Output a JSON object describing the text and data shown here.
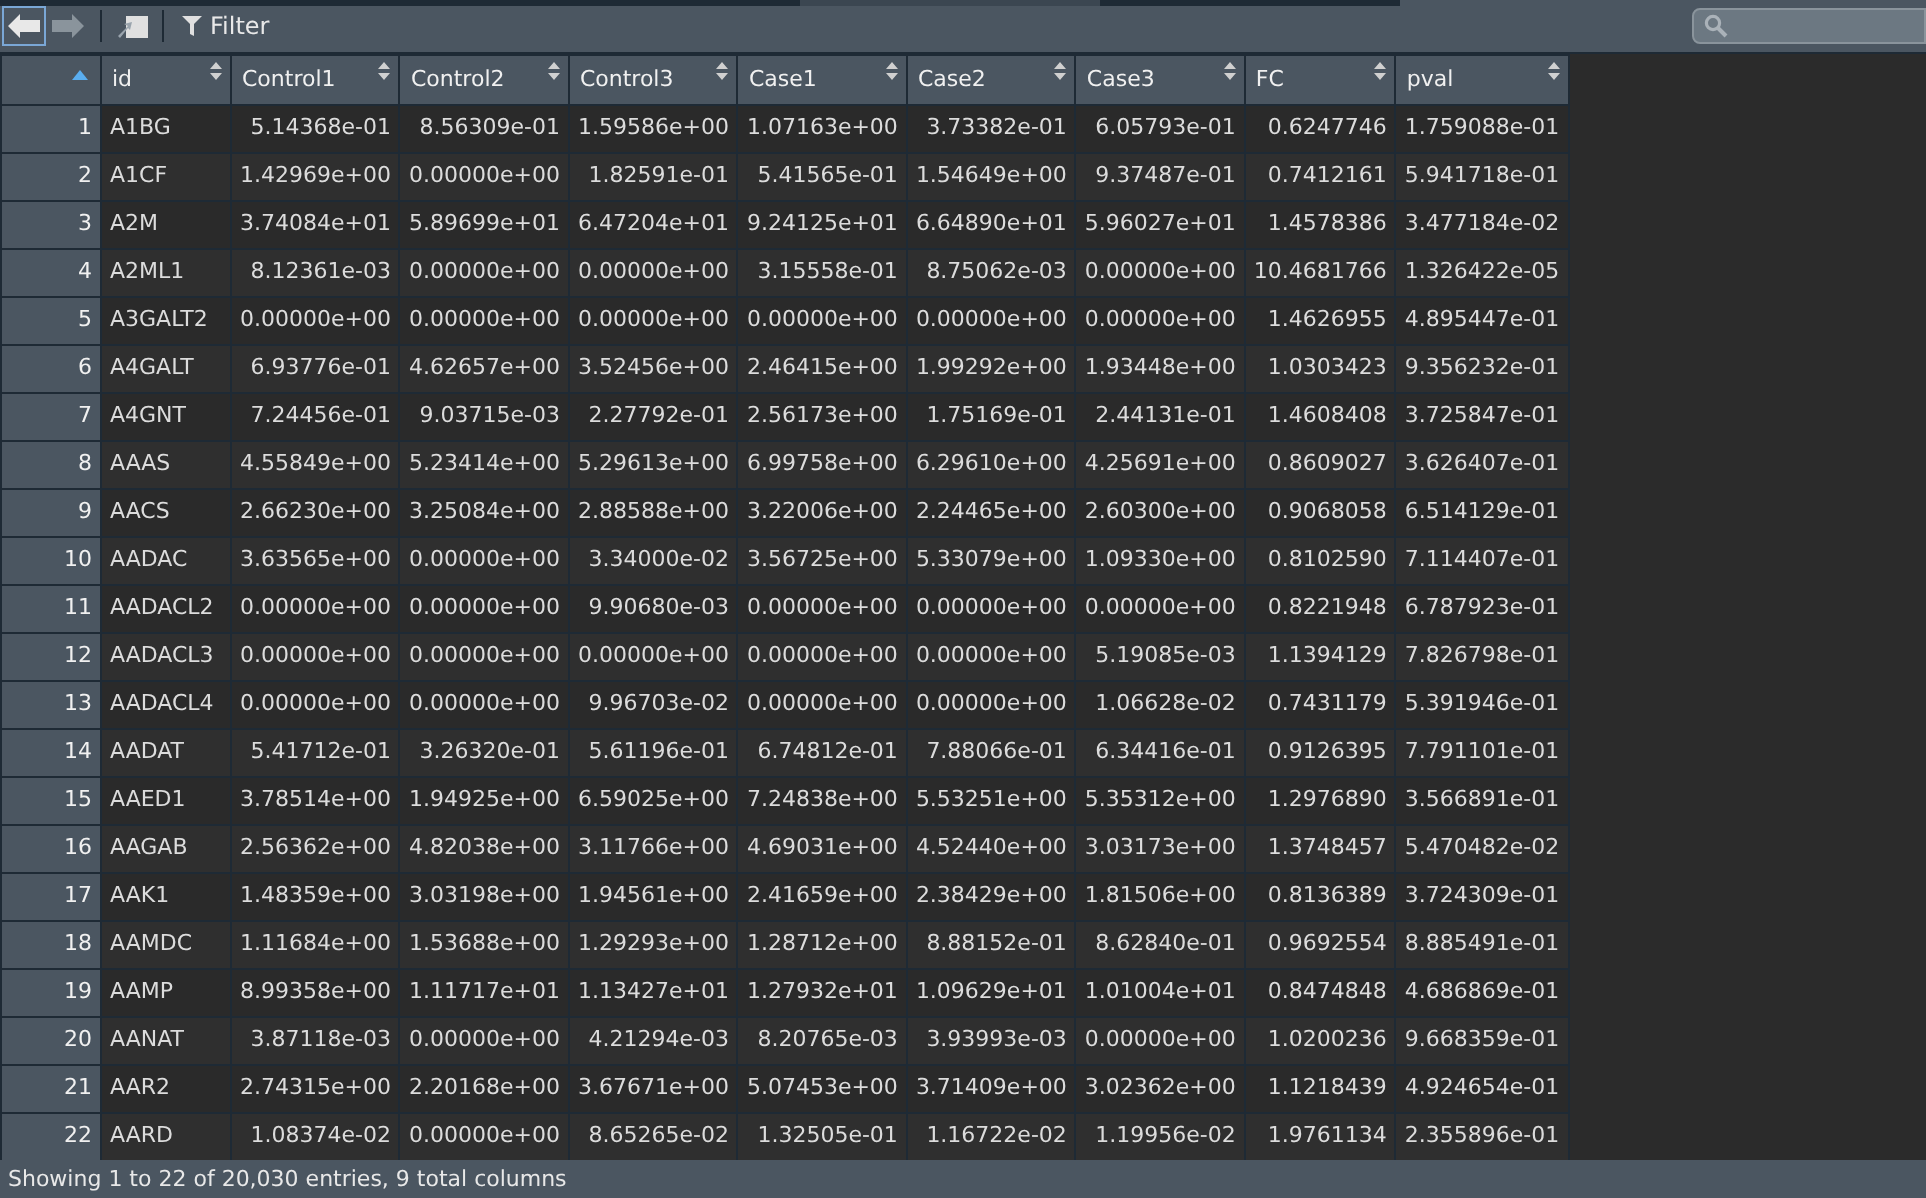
{
  "toolbar": {
    "back": {
      "disabled": false
    },
    "forward": {
      "disabled": true
    },
    "filter_label": "Filter"
  },
  "table": {
    "columns": [
      "",
      "id",
      "Control1",
      "Control2",
      "Control3",
      "Case1",
      "Case2",
      "Case3",
      "FC",
      "pval"
    ],
    "rows": [
      [
        "1",
        "A1BG",
        "5.14368e-01",
        "8.56309e-01",
        "1.59586e+00",
        "1.07163e+00",
        "3.73382e-01",
        "6.05793e-01",
        "0.6247746",
        "1.759088e-01"
      ],
      [
        "2",
        "A1CF",
        "1.42969e+00",
        "0.00000e+00",
        "1.82591e-01",
        "5.41565e-01",
        "1.54649e+00",
        "9.37487e-01",
        "0.7412161",
        "5.941718e-01"
      ],
      [
        "3",
        "A2M",
        "3.74084e+01",
        "5.89699e+01",
        "6.47204e+01",
        "9.24125e+01",
        "6.64890e+01",
        "5.96027e+01",
        "1.4578386",
        "3.477184e-02"
      ],
      [
        "4",
        "A2ML1",
        "8.12361e-03",
        "0.00000e+00",
        "0.00000e+00",
        "3.15558e-01",
        "8.75062e-03",
        "0.00000e+00",
        "10.4681766",
        "1.326422e-05"
      ],
      [
        "5",
        "A3GALT2",
        "0.00000e+00",
        "0.00000e+00",
        "0.00000e+00",
        "0.00000e+00",
        "0.00000e+00",
        "0.00000e+00",
        "1.4626955",
        "4.895447e-01"
      ],
      [
        "6",
        "A4GALT",
        "6.93776e-01",
        "4.62657e+00",
        "3.52456e+00",
        "2.46415e+00",
        "1.99292e+00",
        "1.93448e+00",
        "1.0303423",
        "9.356232e-01"
      ],
      [
        "7",
        "A4GNT",
        "7.24456e-01",
        "9.03715e-03",
        "2.27792e-01",
        "2.56173e+00",
        "1.75169e-01",
        "2.44131e-01",
        "1.4608408",
        "3.725847e-01"
      ],
      [
        "8",
        "AAAS",
        "4.55849e+00",
        "5.23414e+00",
        "5.29613e+00",
        "6.99758e+00",
        "6.29610e+00",
        "4.25691e+00",
        "0.8609027",
        "3.626407e-01"
      ],
      [
        "9",
        "AACS",
        "2.66230e+00",
        "3.25084e+00",
        "2.88588e+00",
        "3.22006e+00",
        "2.24465e+00",
        "2.60300e+00",
        "0.9068058",
        "6.514129e-01"
      ],
      [
        "10",
        "AADAC",
        "3.63565e+00",
        "0.00000e+00",
        "3.34000e-02",
        "3.56725e+00",
        "5.33079e+00",
        "1.09330e+00",
        "0.8102590",
        "7.114407e-01"
      ],
      [
        "11",
        "AADACL2",
        "0.00000e+00",
        "0.00000e+00",
        "9.90680e-03",
        "0.00000e+00",
        "0.00000e+00",
        "0.00000e+00",
        "0.8221948",
        "6.787923e-01"
      ],
      [
        "12",
        "AADACL3",
        "0.00000e+00",
        "0.00000e+00",
        "0.00000e+00",
        "0.00000e+00",
        "0.00000e+00",
        "5.19085e-03",
        "1.1394129",
        "7.826798e-01"
      ],
      [
        "13",
        "AADACL4",
        "0.00000e+00",
        "0.00000e+00",
        "9.96703e-02",
        "0.00000e+00",
        "0.00000e+00",
        "1.06628e-02",
        "0.7431179",
        "5.391946e-01"
      ],
      [
        "14",
        "AADAT",
        "5.41712e-01",
        "3.26320e-01",
        "5.61196e-01",
        "6.74812e-01",
        "7.88066e-01",
        "6.34416e-01",
        "0.9126395",
        "7.791101e-01"
      ],
      [
        "15",
        "AAED1",
        "3.78514e+00",
        "1.94925e+00",
        "6.59025e+00",
        "7.24838e+00",
        "5.53251e+00",
        "5.35312e+00",
        "1.2976890",
        "3.566891e-01"
      ],
      [
        "16",
        "AAGAB",
        "2.56362e+00",
        "4.82038e+00",
        "3.11766e+00",
        "4.69031e+00",
        "4.52440e+00",
        "3.03173e+00",
        "1.3748457",
        "5.470482e-02"
      ],
      [
        "17",
        "AAK1",
        "1.48359e+00",
        "3.03198e+00",
        "1.94561e+00",
        "2.41659e+00",
        "2.38429e+00",
        "1.81506e+00",
        "0.8136389",
        "3.724309e-01"
      ],
      [
        "18",
        "AAMDC",
        "1.11684e+00",
        "1.53688e+00",
        "1.29293e+00",
        "1.28712e+00",
        "8.88152e-01",
        "8.62840e-01",
        "0.9692554",
        "8.885491e-01"
      ],
      [
        "19",
        "AAMP",
        "8.99358e+00",
        "1.11717e+01",
        "1.13427e+01",
        "1.27932e+01",
        "1.09629e+01",
        "1.01004e+01",
        "0.8474848",
        "4.686869e-01"
      ],
      [
        "20",
        "AANAT",
        "3.87118e-03",
        "0.00000e+00",
        "4.21294e-03",
        "8.20765e-03",
        "3.93993e-03",
        "0.00000e+00",
        "1.0200236",
        "9.668359e-01"
      ],
      [
        "21",
        "AAR2",
        "2.74315e+00",
        "2.20168e+00",
        "3.67671e+00",
        "5.07453e+00",
        "3.71409e+00",
        "3.02362e+00",
        "1.1218439",
        "4.924654e-01"
      ],
      [
        "22",
        "AARD",
        "1.08374e-02",
        "0.00000e+00",
        "8.65265e-02",
        "1.32505e-01",
        "1.16722e-02",
        "1.19956e-02",
        "1.9761134",
        "2.355896e-01"
      ]
    ]
  },
  "status_bar": "Showing 1 to 22 of 20,030 entries, 9 total columns"
}
